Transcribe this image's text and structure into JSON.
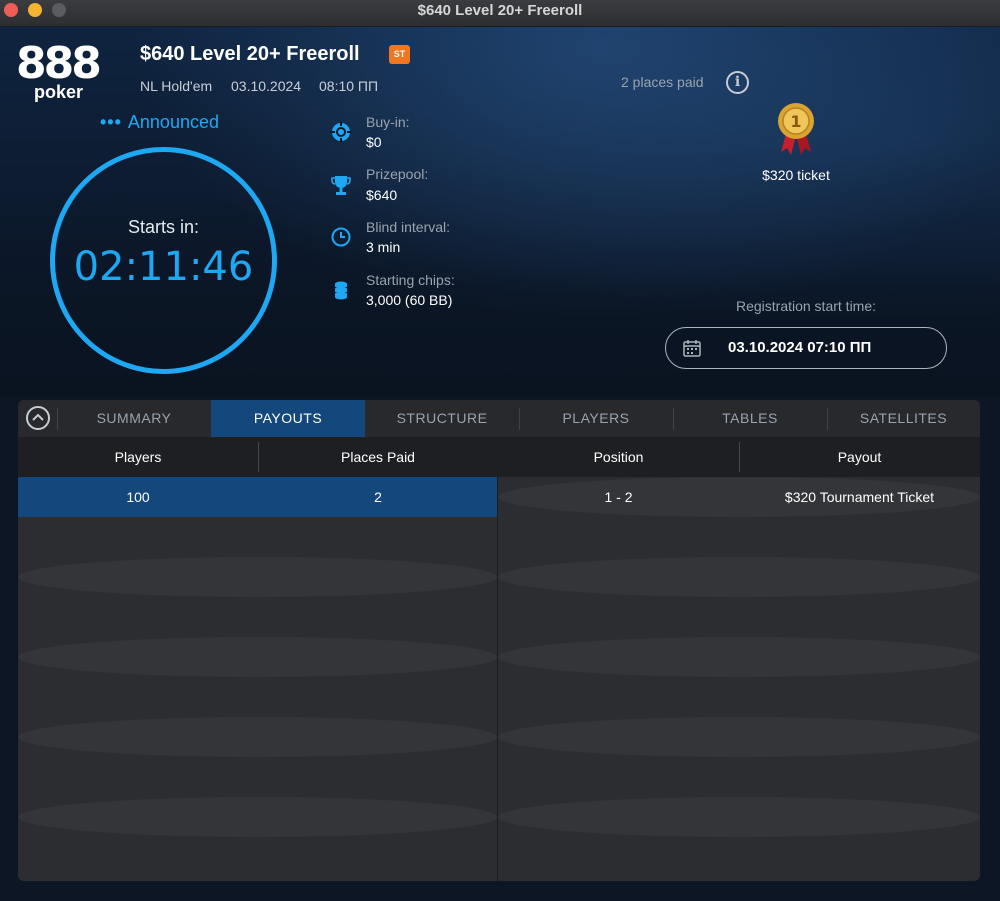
{
  "window": {
    "title": "$640 Level 20+ Freeroll"
  },
  "logo": {
    "digits": "888",
    "word": "poker"
  },
  "tournament": {
    "title": "$640 Level 20+ Freeroll",
    "badge": "ST",
    "game": "NL Hold'em",
    "date": "03.10.2024",
    "time": "08:10 ПП",
    "status": "Announced",
    "starts_label": "Starts in:",
    "countdown": "02:11:46"
  },
  "info": [
    {
      "label": "Buy-in:",
      "value": "$0",
      "icon": "poker-chip-icon"
    },
    {
      "label": "Prizepool:",
      "value": "$640",
      "icon": "trophy-icon"
    },
    {
      "label": "Blind interval:",
      "value": "3 min",
      "icon": "clock-icon"
    },
    {
      "label": "Starting chips:",
      "value": "3,000 (60 BB)",
      "icon": "chip-stack-icon"
    }
  ],
  "prizes": {
    "places_paid": "2 places paid",
    "medal_number": "1",
    "first_prize": "$320 ticket"
  },
  "registration": {
    "label": "Registration start time:",
    "value": "03.10.2024 07:10 ПП"
  },
  "tabs": [
    {
      "label": "SUMMARY",
      "active": false
    },
    {
      "label": "PAYOUTS",
      "active": true
    },
    {
      "label": "STRUCTURE",
      "active": false
    },
    {
      "label": "PLAYERS",
      "active": false
    },
    {
      "label": "TABLES",
      "active": false
    },
    {
      "label": "SATELLITES",
      "active": false
    }
  ],
  "payouts": {
    "columns": [
      "Players",
      "Places Paid",
      "Position",
      "Payout"
    ],
    "left_rows": [
      {
        "players": "100",
        "places_paid": "2"
      }
    ],
    "right_rows": [
      {
        "position": "1 - 2",
        "payout": "$320 Tournament Ticket"
      }
    ]
  },
  "colors": {
    "accent": "#1ea8f3",
    "active_tab": "#14487d",
    "badge": "#f2751f",
    "medal_gold": "#d9a431",
    "ribbon": "#c8202a"
  }
}
